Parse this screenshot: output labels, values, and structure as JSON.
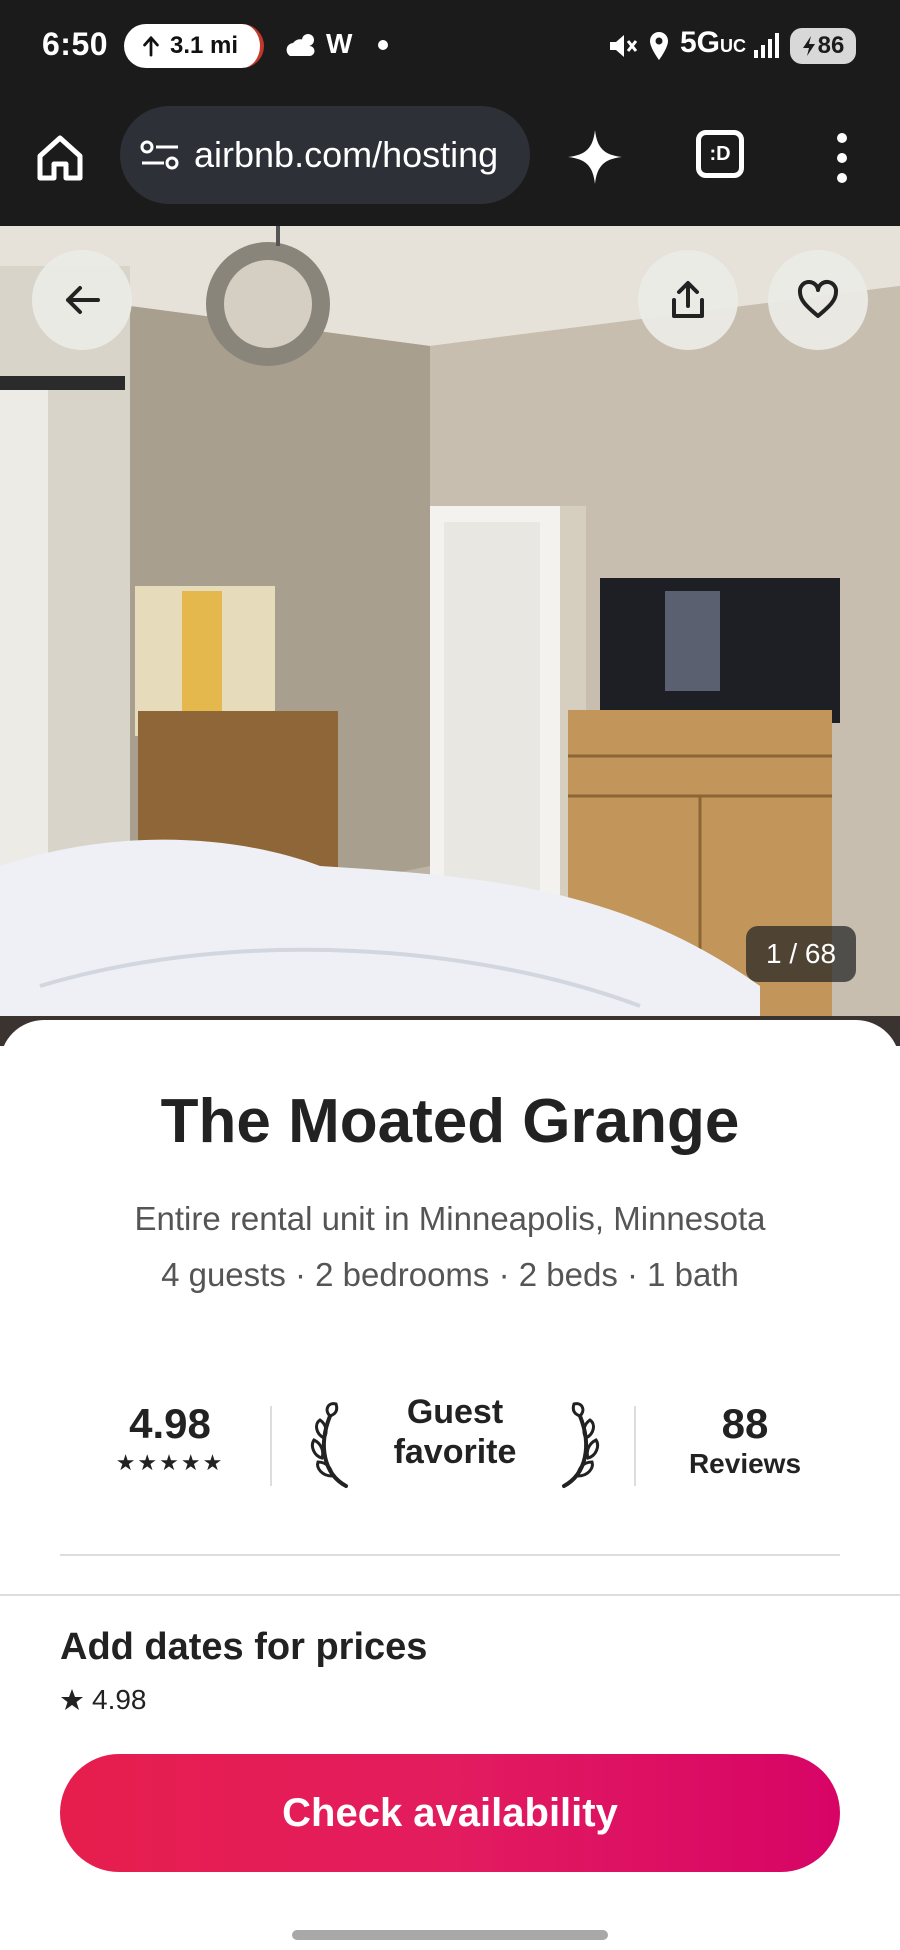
{
  "status_bar": {
    "time": "6:50",
    "nav_distance": "3.1 mi",
    "weather_letter": "W",
    "network": "5G",
    "network_suffix": "UC",
    "battery": "86"
  },
  "browser": {
    "url": "airbnb.com/hosting",
    "tabs_label": ":D"
  },
  "photo": {
    "counter": "1 / 68"
  },
  "listing": {
    "title": "The Moated Grange",
    "subtitle": "Entire rental unit in Minneapolis, Minnesota",
    "details": "4 guests · 2 bedrooms · 2 beds · 1 bath",
    "rating": "4.98",
    "stars": "★★★★★",
    "guest_favorite_line1": "Guest",
    "guest_favorite_line2": "favorite",
    "reviews_count": "88",
    "reviews_label": "Reviews"
  },
  "footer": {
    "title": "Add dates for prices",
    "rating": "4.98",
    "cta_label": "Check availability"
  },
  "colors": {
    "brand": "#e31c5f",
    "status_bar_bg": "#1b1b1b",
    "url_box_bg": "#2e3038"
  }
}
